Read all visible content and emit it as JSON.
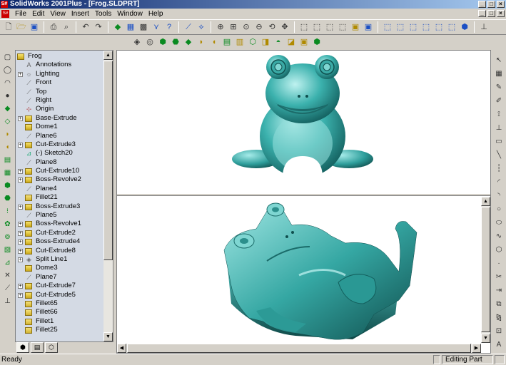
{
  "window": {
    "title": "SolidWorks 2001Plus - [Frog.SLDPRT]",
    "app_icon": "S#",
    "controls": [
      "_",
      "□",
      "×"
    ]
  },
  "menu": {
    "items": [
      "File",
      "Edit",
      "View",
      "Insert",
      "Tools",
      "Window",
      "Help"
    ]
  },
  "toolbar_standard": {
    "icons": [
      "new-icon",
      "open-icon",
      "save-icon",
      "print-icon",
      "print-preview-icon",
      "undo-icon",
      "redo-icon",
      "rebuild-icon",
      "options-icon",
      "help-icon",
      "zoom-icon",
      "rotate-icon",
      "pan-icon",
      "view-orientation-icon"
    ]
  },
  "toolbar_features": {
    "icons": [
      "extrude-icon",
      "revolve-icon",
      "sweep-icon",
      "loft-icon",
      "cut-icon",
      "fillet-icon",
      "chamfer-icon",
      "shell-icon",
      "pattern-icon",
      "mirror-icon"
    ]
  },
  "feature_tree": {
    "root": "Frog",
    "items": [
      {
        "label": "Annotations",
        "icon": "annotations-icon",
        "expandable": false
      },
      {
        "label": "Lighting",
        "icon": "lighting-icon",
        "expandable": true
      },
      {
        "label": "Front",
        "icon": "plane-icon",
        "expandable": false
      },
      {
        "label": "Top",
        "icon": "plane-icon",
        "expandable": false
      },
      {
        "label": "Right",
        "icon": "plane-icon",
        "expandable": false
      },
      {
        "label": "Origin",
        "icon": "origin-icon",
        "expandable": false
      },
      {
        "label": "Base-Extrude",
        "icon": "feature-icon",
        "expandable": true
      },
      {
        "label": "Dome1",
        "icon": "feature-icon",
        "expandable": false
      },
      {
        "label": "Plane6",
        "icon": "plane-icon",
        "expandable": false
      },
      {
        "label": "Cut-Extrude3",
        "icon": "feature-icon",
        "expandable": true
      },
      {
        "label": "(-) Sketch20",
        "icon": "sketch-icon",
        "expandable": false
      },
      {
        "label": "Plane8",
        "icon": "plane-icon",
        "expandable": false
      },
      {
        "label": "Cut-Extrude10",
        "icon": "feature-icon",
        "expandable": true
      },
      {
        "label": "Boss-Revolve2",
        "icon": "feature-icon",
        "expandable": true
      },
      {
        "label": "Plane4",
        "icon": "plane-icon",
        "expandable": false
      },
      {
        "label": "Fillet21",
        "icon": "fillet-icon",
        "expandable": false
      },
      {
        "label": "Boss-Extrude3",
        "icon": "feature-icon",
        "expandable": true
      },
      {
        "label": "Plane5",
        "icon": "plane-icon",
        "expandable": false
      },
      {
        "label": "Boss-Revolve1",
        "icon": "feature-icon",
        "expandable": true
      },
      {
        "label": "Cut-Extrude2",
        "icon": "feature-icon",
        "expandable": true
      },
      {
        "label": "Boss-Extrude4",
        "icon": "feature-icon",
        "expandable": true
      },
      {
        "label": "Cut-Extrude8",
        "icon": "feature-icon",
        "expandable": true
      },
      {
        "label": "Split Line1",
        "icon": "split-line-icon",
        "expandable": true
      },
      {
        "label": "Dome3",
        "icon": "feature-icon",
        "expandable": false
      },
      {
        "label": "Plane7",
        "icon": "plane-icon",
        "expandable": false
      },
      {
        "label": "Cut-Extrude7",
        "icon": "feature-icon",
        "expandable": true
      },
      {
        "label": "Cut-Extrude5",
        "icon": "feature-icon",
        "expandable": true
      },
      {
        "label": "Fillet65",
        "icon": "fillet-icon",
        "expandable": false
      },
      {
        "label": "Fillet66",
        "icon": "fillet-icon",
        "expandable": false
      },
      {
        "label": "Fillet1",
        "icon": "fillet-icon",
        "expandable": false
      },
      {
        "label": "Fillet25",
        "icon": "fillet-icon",
        "expandable": false
      }
    ]
  },
  "panel_tabs": [
    "feature-manager-tab",
    "property-manager-tab",
    "configuration-manager-tab"
  ],
  "status": {
    "left": "Ready",
    "mode": "Editing Part"
  },
  "colors": {
    "titlebar": "#0a246a",
    "model": "#2fa3a3",
    "panel": "#d4dae4"
  }
}
